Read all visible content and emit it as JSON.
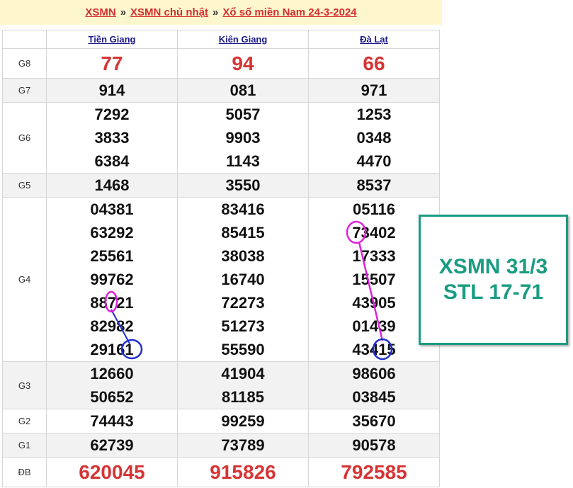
{
  "breadcrumb": {
    "items": [
      "XSMN",
      "XSMN chủ nhật",
      "Xổ số miền Nam 24-3-2024"
    ],
    "separator": "»"
  },
  "table": {
    "provinces": [
      "Tiền Giang",
      "Kiên Giang",
      "Đà Lạt"
    ],
    "rows": [
      {
        "label": "G8",
        "values": [
          [
            "77"
          ],
          [
            "94"
          ],
          [
            "66"
          ]
        ]
      },
      {
        "label": "G7",
        "values": [
          [
            "914"
          ],
          [
            "081"
          ],
          [
            "971"
          ]
        ]
      },
      {
        "label": "G6",
        "values": [
          [
            "7292",
            "3833",
            "6384"
          ],
          [
            "5057",
            "9903",
            "1143"
          ],
          [
            "1253",
            "0348",
            "4470"
          ]
        ]
      },
      {
        "label": "G5",
        "values": [
          [
            "1468"
          ],
          [
            "3550"
          ],
          [
            "8537"
          ]
        ]
      },
      {
        "label": "G4",
        "values": [
          [
            "04381",
            "63292",
            "25561",
            "99762",
            "88721",
            "82982",
            "29161"
          ],
          [
            "83416",
            "85415",
            "38038",
            "16740",
            "72273",
            "51273",
            "55590"
          ],
          [
            "05116",
            "73402",
            "17333",
            "15507",
            "43905",
            "01439",
            "43415"
          ]
        ]
      },
      {
        "label": "G3",
        "values": [
          [
            "12660",
            "50652"
          ],
          [
            "41904",
            "81185"
          ],
          [
            "98606",
            "03845"
          ]
        ]
      },
      {
        "label": "G2",
        "values": [
          [
            "74443"
          ],
          [
            "99259"
          ],
          [
            "35670"
          ]
        ]
      },
      {
        "label": "G1",
        "values": [
          [
            "62739"
          ],
          [
            "73789"
          ],
          [
            "90578"
          ]
        ]
      },
      {
        "label": "ĐB",
        "values": [
          [
            "620045"
          ],
          [
            "915826"
          ],
          [
            "792585"
          ]
        ]
      }
    ]
  },
  "note": {
    "line1": "XSMN 31/3",
    "line2": "STL 17-71"
  },
  "colors": {
    "accent_red": "#d63434",
    "note_teal": "#1a9c82",
    "marker_magenta": "#e020e0",
    "marker_blue": "#2030d0"
  }
}
